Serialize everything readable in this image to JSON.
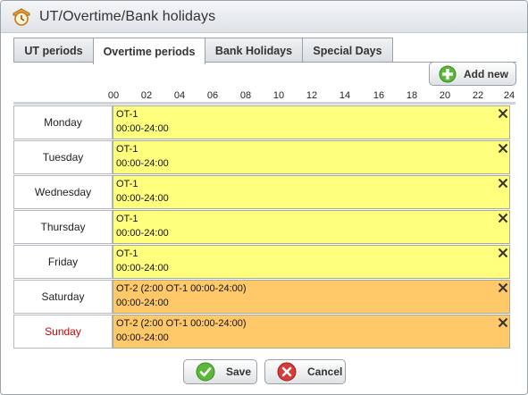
{
  "window": {
    "title": "UT/Overtime/Bank holidays",
    "icon": "overtime-clock-icon"
  },
  "tabs": [
    {
      "label": "UT periods",
      "active": false
    },
    {
      "label": "Overtime periods",
      "active": true
    },
    {
      "label": "Bank Holidays",
      "active": false
    },
    {
      "label": "Special Days",
      "active": false
    }
  ],
  "toolbar": {
    "add_label": "Add new",
    "add_icon": "plus-circle-icon"
  },
  "timeline": {
    "ticks": [
      "00",
      "02",
      "04",
      "06",
      "08",
      "10",
      "12",
      "14",
      "16",
      "18",
      "20",
      "22",
      "24"
    ]
  },
  "rows": [
    {
      "day": "Monday",
      "line1": "OT-1",
      "line2": "00:00-24:00",
      "color": "#ffff7d"
    },
    {
      "day": "Tuesday",
      "line1": "OT-1",
      "line2": "00:00-24:00",
      "color": "#ffff7d"
    },
    {
      "day": "Wednesday",
      "line1": "OT-1",
      "line2": "00:00-24:00",
      "color": "#ffff7d"
    },
    {
      "day": "Thursday",
      "line1": "OT-1",
      "line2": "00:00-24:00",
      "color": "#ffff7d"
    },
    {
      "day": "Friday",
      "line1": "OT-1",
      "line2": "00:00-24:00",
      "color": "#ffff7d"
    },
    {
      "day": "Saturday",
      "line1": "OT-2 (2:00 OT-1 00:00-24:00)",
      "line2": "00:00-24:00",
      "color": "#ffc96a"
    },
    {
      "day": "Sunday",
      "line1": "OT-2 (2:00 OT-1 00:00-24:00)",
      "line2": "00:00-24:00",
      "color": "#ffc96a",
      "day_color": "#cc0000"
    }
  ],
  "footer": {
    "save_label": "Save",
    "cancel_label": "Cancel"
  },
  "colors": {
    "weekday_bar": "#ffff7d",
    "weekend_bar": "#ffc96a",
    "sunday_text": "#cc0000"
  }
}
